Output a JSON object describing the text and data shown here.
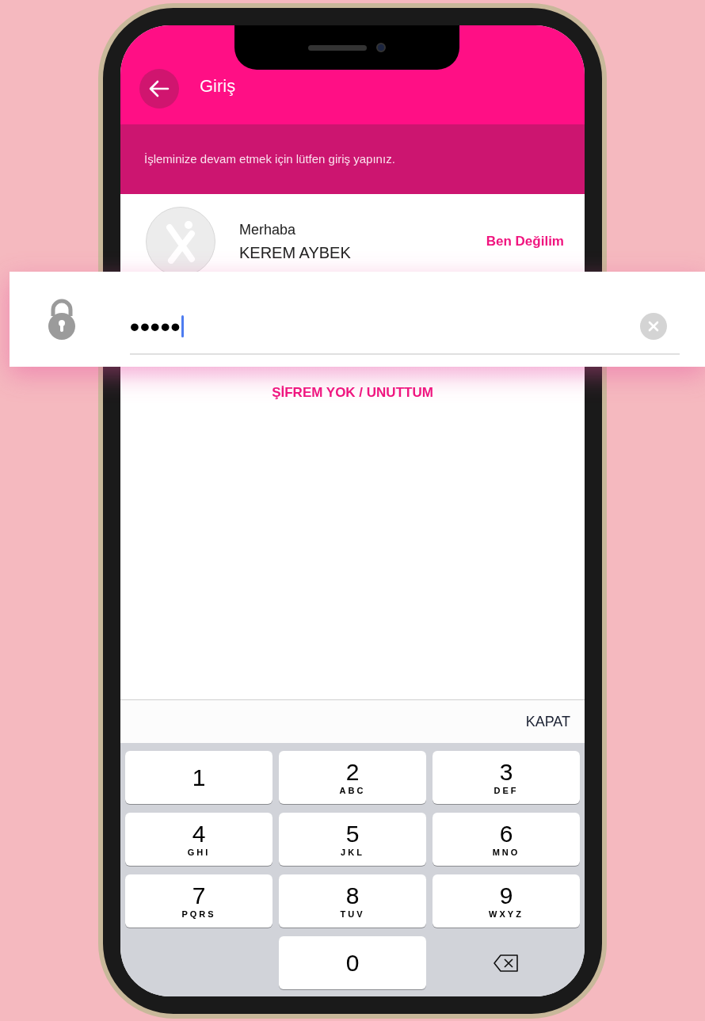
{
  "header": {
    "title": "Giriş"
  },
  "notice": "İşleminize devam etmek için lütfen giriş yapınız.",
  "user": {
    "greeting": "Merhaba",
    "name": "KEREM AYBEK",
    "switch_link": "Ben Değilim"
  },
  "password": {
    "value": "•••••",
    "focused": true
  },
  "forgot_link": "ŞİFREM YOK / UNUTTUM",
  "keyboard": {
    "close": "KAPAT",
    "keys": [
      {
        "kind": "digit",
        "digit": "1"
      },
      {
        "kind": "digit",
        "digit": "2",
        "letters": "ABC"
      },
      {
        "kind": "digit",
        "digit": "3",
        "letters": "DEF"
      },
      {
        "kind": "digit",
        "digit": "4",
        "letters": "GHI"
      },
      {
        "kind": "digit",
        "digit": "5",
        "letters": "JKL"
      },
      {
        "kind": "digit",
        "digit": "6",
        "letters": "MNO"
      },
      {
        "kind": "digit",
        "digit": "7",
        "letters": "PQRS"
      },
      {
        "kind": "digit",
        "digit": "8",
        "letters": "TUV"
      },
      {
        "kind": "digit",
        "digit": "9",
        "letters": "WXYZ"
      },
      {
        "kind": "blank"
      },
      {
        "kind": "digit",
        "digit": "0"
      },
      {
        "kind": "delete"
      }
    ]
  }
}
